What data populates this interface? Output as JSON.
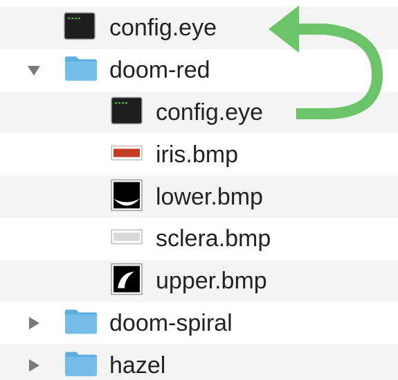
{
  "file_list": {
    "items": [
      {
        "name": "config.eye",
        "type": "terminal-file",
        "level": 0,
        "disclosure": "none"
      },
      {
        "name": "doom-red",
        "type": "folder",
        "level": 0,
        "disclosure": "expanded"
      },
      {
        "name": "config.eye",
        "type": "terminal-file",
        "level": 1,
        "disclosure": "none"
      },
      {
        "name": "iris.bmp",
        "type": "bmp-iris",
        "level": 1,
        "disclosure": "none"
      },
      {
        "name": "lower.bmp",
        "type": "bmp-lower",
        "level": 1,
        "disclosure": "none"
      },
      {
        "name": "sclera.bmp",
        "type": "bmp-sclera",
        "level": 1,
        "disclosure": "none"
      },
      {
        "name": "upper.bmp",
        "type": "bmp-upper",
        "level": 1,
        "disclosure": "none"
      },
      {
        "name": "doom-spiral",
        "type": "folder",
        "level": 0,
        "disclosure": "collapsed"
      },
      {
        "name": "hazel",
        "type": "folder",
        "level": 0,
        "disclosure": "collapsed"
      }
    ]
  },
  "colors": {
    "arrow": "#6cc46a",
    "folder": "#74bde9",
    "folder_tab": "#5aaee0",
    "stripe": "#f4f4f4",
    "iris": "#c23b22",
    "sclera": "#d9d9d9",
    "terminal": "#1e1e1e"
  },
  "annotation": {
    "arrow_icon": "curved-return-arrow-icon"
  }
}
